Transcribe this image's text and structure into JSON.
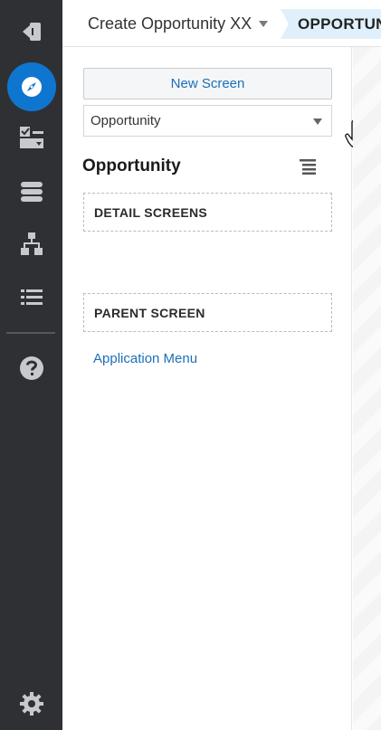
{
  "header": {
    "screen_name": "Create Opportunity XX",
    "breadcrumb": "OPPORTUNITY"
  },
  "sidebar": {
    "icons": [
      "exit-icon",
      "compass-icon",
      "screen-controls-icon",
      "database-icon",
      "hierarchy-icon",
      "list-icon",
      "help-icon",
      "settings-gear-icon"
    ],
    "active": "compass-icon"
  },
  "panel": {
    "new_screen_label": "New Screen",
    "entity_selected": "Opportunity",
    "section_title": "Opportunity",
    "detail_screens_label": "DETAIL SCREENS",
    "parent_screen_label": "PARENT SCREEN",
    "application_menu_link": "Application Menu"
  },
  "colors": {
    "rail_bg": "#2f3033",
    "accent": "#0f76cf",
    "link": "#1c6fb8",
    "breadcrumb_bg": "#dff0fc"
  }
}
